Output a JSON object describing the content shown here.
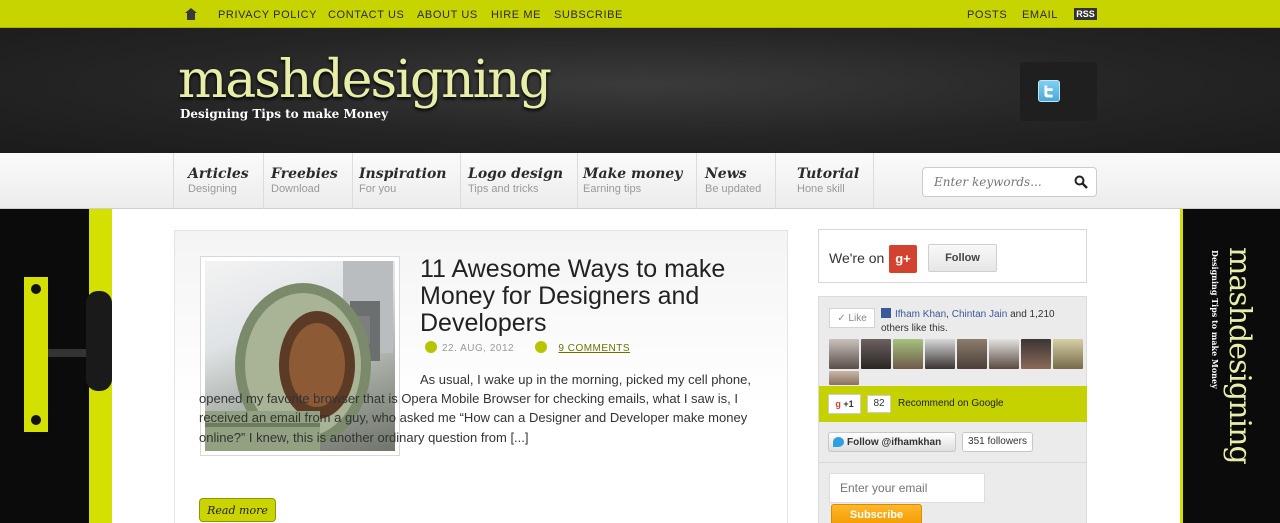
{
  "topbar": {
    "left_links": [
      "PRIVACY POLICY",
      "CONTACT US",
      "ABOUT US",
      "HIRE ME",
      "SUBSCRIBE"
    ],
    "right_links": [
      "POSTS",
      "EMAIL"
    ],
    "rss_label": "RSS"
  },
  "header": {
    "logo_text": "mashdesigning",
    "tagline": "Designing Tips to make Money"
  },
  "nav": {
    "items": [
      {
        "title": "Articles",
        "subtitle": "Designing"
      },
      {
        "title": "Freebies",
        "subtitle": "Download"
      },
      {
        "title": "Inspiration",
        "subtitle": "For you"
      },
      {
        "title": "Logo design",
        "subtitle": "Tips and tricks"
      },
      {
        "title": "Make money",
        "subtitle": "Earning tips"
      },
      {
        "title": "News",
        "subtitle": "Be updated"
      },
      {
        "title": "Tutorial",
        "subtitle": "Hone skill"
      }
    ],
    "search_placeholder": "Enter keywords..."
  },
  "post": {
    "title": "11 Awesome Ways to make Money for Designers and Developers",
    "date": "22. AUG, 2012",
    "comments": "9 COMMENTS",
    "excerpt": "As usual, I wake up in the morning, picked my cell phone, opened my favorite browser that is Opera Mobile Browser for checking emails, what I saw is, I received an email from a guy, who asked me “How can a Designer and Developer make money online?” I knew, this is another ordinary question from [...]",
    "read_more": "Read more"
  },
  "sidebar": {
    "gplus_prefix": "We're on",
    "gplus_badge": "g+",
    "follow_label": "Follow",
    "fb_like_label": "Like",
    "fb_names": [
      "Ifham Khan",
      "Chintan Jain"
    ],
    "fb_connector": ",",
    "fb_rest": "and 1,210 others like this.",
    "gplus_one_label": "+1",
    "gplus_count": "82",
    "gplus_recommend": "Recommend on Google",
    "twitter_follow": "Follow @ifhamkhan",
    "twitter_followers": "351 followers",
    "email_placeholder": "Enter your email",
    "subscribe_label": "Subscribe"
  },
  "colors": {
    "accent": "#c8d400",
    "dark": "#222222",
    "subscribe": "#f5a300"
  }
}
